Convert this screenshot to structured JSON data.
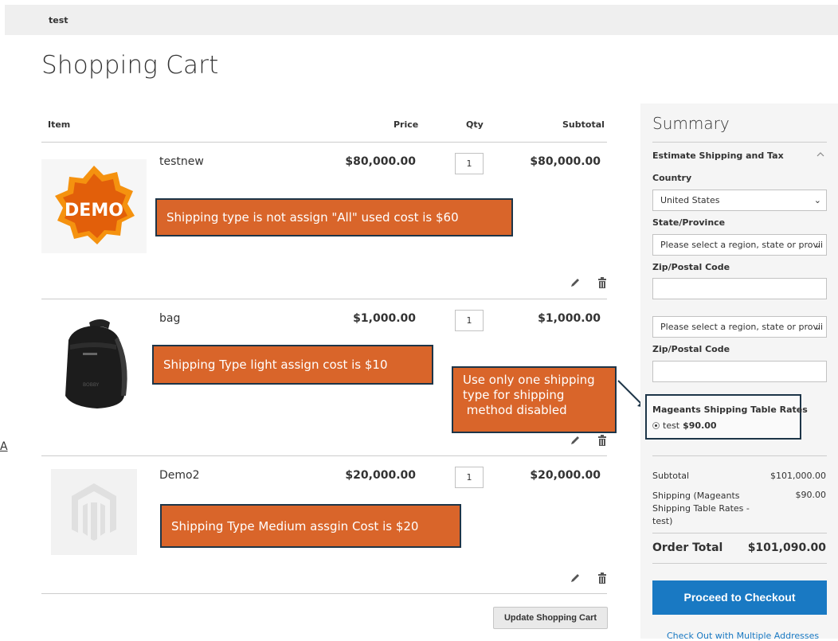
{
  "header": {
    "store_text": "test"
  },
  "page": {
    "title": "Shopping Cart"
  },
  "cart": {
    "columns": {
      "item": "Item",
      "price": "Price",
      "qty": "Qty",
      "subtotal": "Subtotal"
    },
    "items": [
      {
        "name": "testnew",
        "price": "$80,000.00",
        "qty": "1",
        "subtotal": "$80,000.00",
        "image": "DEMO"
      },
      {
        "name": "bag",
        "price": "$1,000.00",
        "qty": "1",
        "subtotal": "$1,000.00",
        "image": "backpack"
      },
      {
        "name": "Demo2",
        "price": "$20,000.00",
        "qty": "1",
        "subtotal": "$20,000.00",
        "image": "placeholder"
      }
    ],
    "update_button": "Update Shopping Cart",
    "icons": {
      "edit": "pencil-icon",
      "delete": "trash-icon"
    }
  },
  "callouts": {
    "item1": "Shipping type is not assign \"All\" used cost is $60",
    "item2": "Shipping Type light assign cost is $10",
    "item3": "Shipping Type Medium assgin Cost is $20",
    "shipping_note_line1": "Use only one shipping",
    "shipping_note_line2": "type for shipping",
    "shipping_note_line3": " method disabled"
  },
  "summary": {
    "title": "Summary",
    "estimate_title": "Estimate Shipping and Tax",
    "country_label": "Country",
    "country_value": "United States",
    "state_label": "State/Province",
    "state_placeholder": "Please select a region, state or provii",
    "zip_label": "Zip/Postal Code",
    "state_placeholder_2": "Please select a region, state or provii",
    "zip_label_2": "Zip/Postal Code",
    "shipping_method_title": "Mageants Shipping Table Rates",
    "shipping_option_name": "test",
    "shipping_option_price": "$90.00",
    "subtotal_label": "Subtotal",
    "subtotal_value": "$101,000.00",
    "shipping_label_1": "Shipping (Mageants",
    "shipping_label_2": "Shipping Table Rates -",
    "shipping_label_3": "test)",
    "shipping_value": "$90.00",
    "order_total_label": "Order Total",
    "order_total_value": "$101,090.00",
    "checkout_button": "Proceed to Checkout",
    "multi_address_link": "Check Out with Multiple Addresses"
  },
  "left_fragment": "A",
  "colors": {
    "accent_blue": "#1979c3",
    "callout_orange": "#d9652a",
    "callout_border": "#1d3548"
  }
}
